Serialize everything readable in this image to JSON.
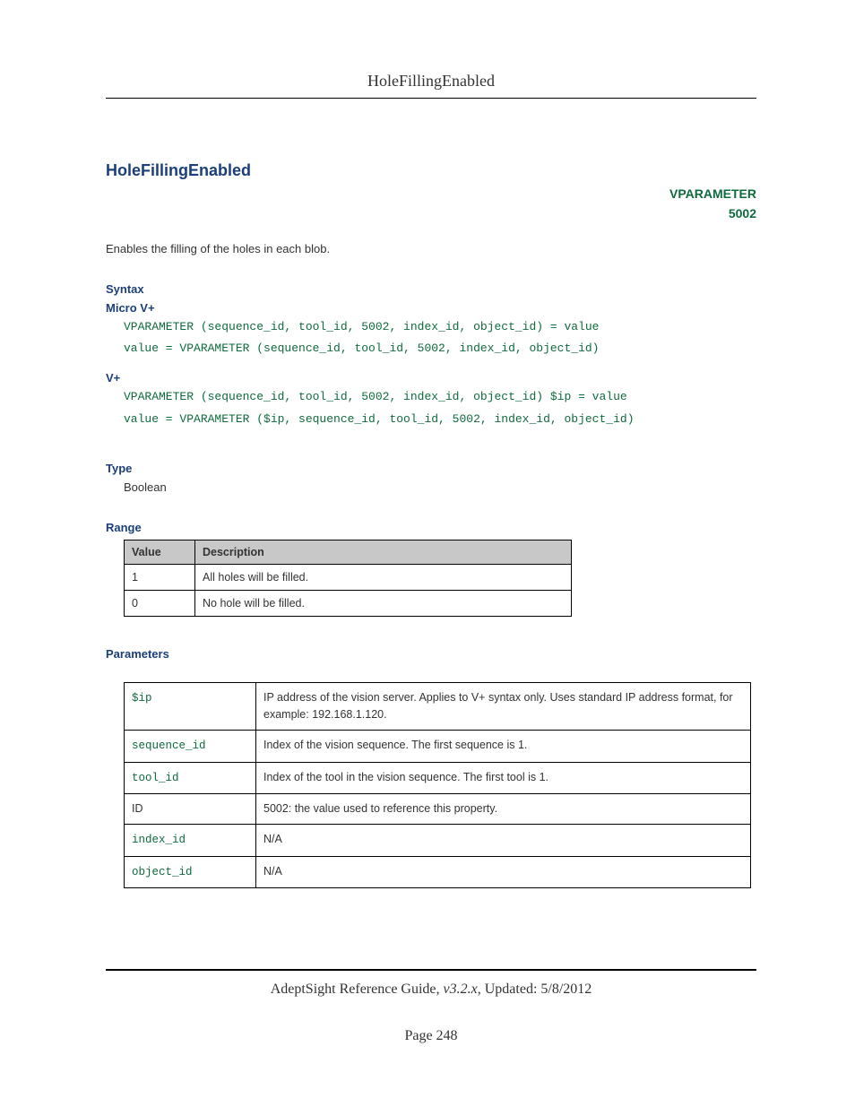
{
  "header": {
    "title": "HoleFillingEnabled"
  },
  "main": {
    "title": "HoleFillingEnabled",
    "vparam_label": "VPARAMETER",
    "vparam_id": "5002",
    "intro": "Enables the filling of the holes in each blob."
  },
  "syntax": {
    "heading": "Syntax",
    "micro_label": "Micro V+",
    "micro_code": "VPARAMETER (sequence_id, tool_id, 5002, index_id, object_id) = value\nvalue = VPARAMETER (sequence_id, tool_id, 5002, index_id, object_id)",
    "vplus_label": "V+",
    "vplus_code": "VPARAMETER (sequence_id, tool_id, 5002, index_id, object_id) $ip = value\nvalue = VPARAMETER ($ip, sequence_id, tool_id, 5002, index_id, object_id)"
  },
  "type": {
    "heading": "Type",
    "value": "Boolean"
  },
  "range": {
    "heading": "Range",
    "col0": "Value",
    "col1": "Description",
    "rows": [
      {
        "v": "1",
        "d": "All holes will be filled."
      },
      {
        "v": "0",
        "d": "No hole will be filled."
      }
    ]
  },
  "parameters": {
    "heading": "Parameters",
    "rows": [
      {
        "k": "$ip",
        "green": true,
        "d": "IP address of the vision server. Applies to V+ syntax only. Uses standard IP address format, for example: 192.168.1.120."
      },
      {
        "k": "sequence_id",
        "green": true,
        "d": "Index of the vision sequence. The first sequence is 1."
      },
      {
        "k": "tool_id",
        "green": true,
        "d": "Index of the tool in the vision sequence. The first tool is 1."
      },
      {
        "k": "ID",
        "green": false,
        "d": "5002: the value used to reference this property."
      },
      {
        "k": "index_id",
        "green": true,
        "d": "N/A"
      },
      {
        "k": "object_id",
        "green": true,
        "d": "N/A"
      }
    ]
  },
  "footer": {
    "guide": "AdeptSight Reference Guide",
    "version": ", v3.2.x",
    "updated": ", Updated: 5/8/2012",
    "page": "Page 248"
  }
}
